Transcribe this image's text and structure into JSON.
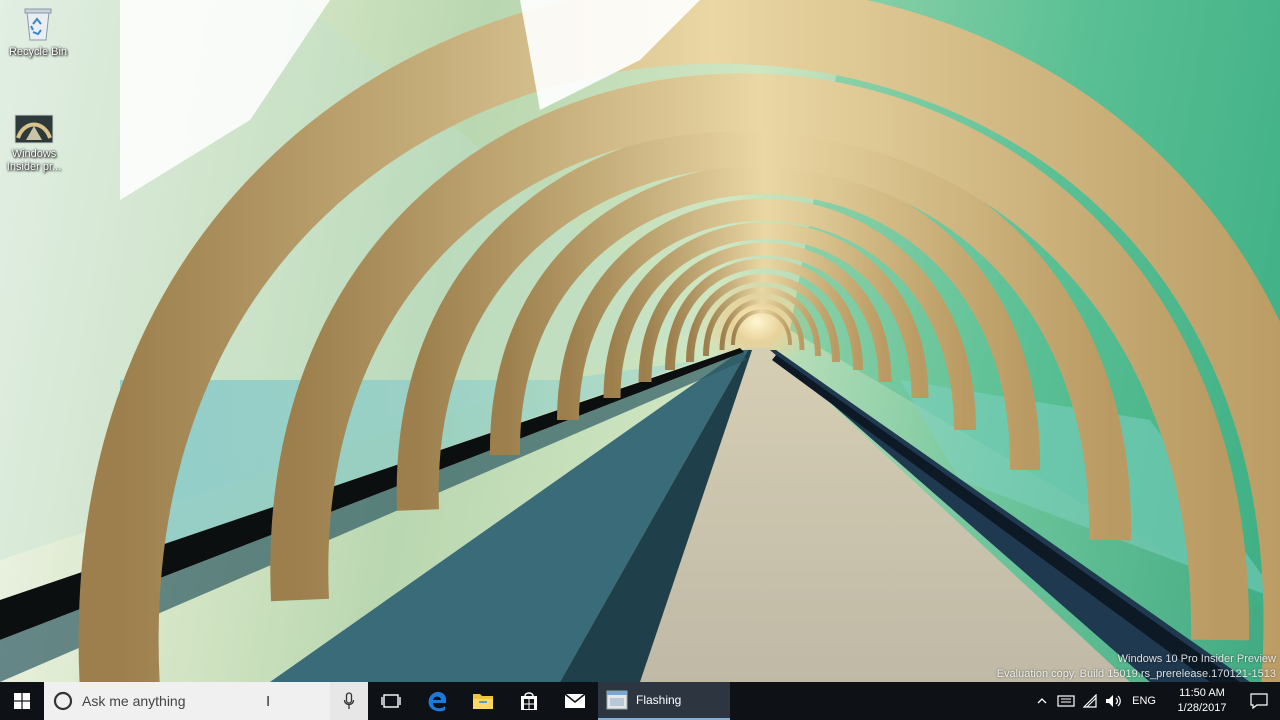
{
  "desktop": {
    "icons": [
      {
        "label": "Recycle Bin",
        "icon": "recycle-bin-icon"
      },
      {
        "label": "Windows Insider pr...",
        "icon": "video-thumbnail-icon"
      }
    ],
    "watermark": {
      "line1": "Windows 10 Pro Insider Preview",
      "line2": "Evaluation copy. Build 15019.rs_prerelease.170121-1513"
    }
  },
  "taskbar": {
    "start_icon": "windows-logo-icon",
    "search": {
      "placeholder": "Ask me anything"
    },
    "apps": [
      {
        "icon": "edge-icon"
      },
      {
        "icon": "file-explorer-icon"
      },
      {
        "icon": "store-icon"
      },
      {
        "icon": "mail-icon"
      }
    ],
    "running_app": {
      "label": "Flashing"
    },
    "tray": {
      "language": "ENG",
      "time": "11:50 AM",
      "date": "1/28/2017"
    }
  },
  "colors": {
    "taskbar_bg": "#0e1216",
    "search_bg": "#f0f0f0",
    "edge_blue": "#1f7ad7",
    "explorer_yellow": "#f2c33c"
  }
}
